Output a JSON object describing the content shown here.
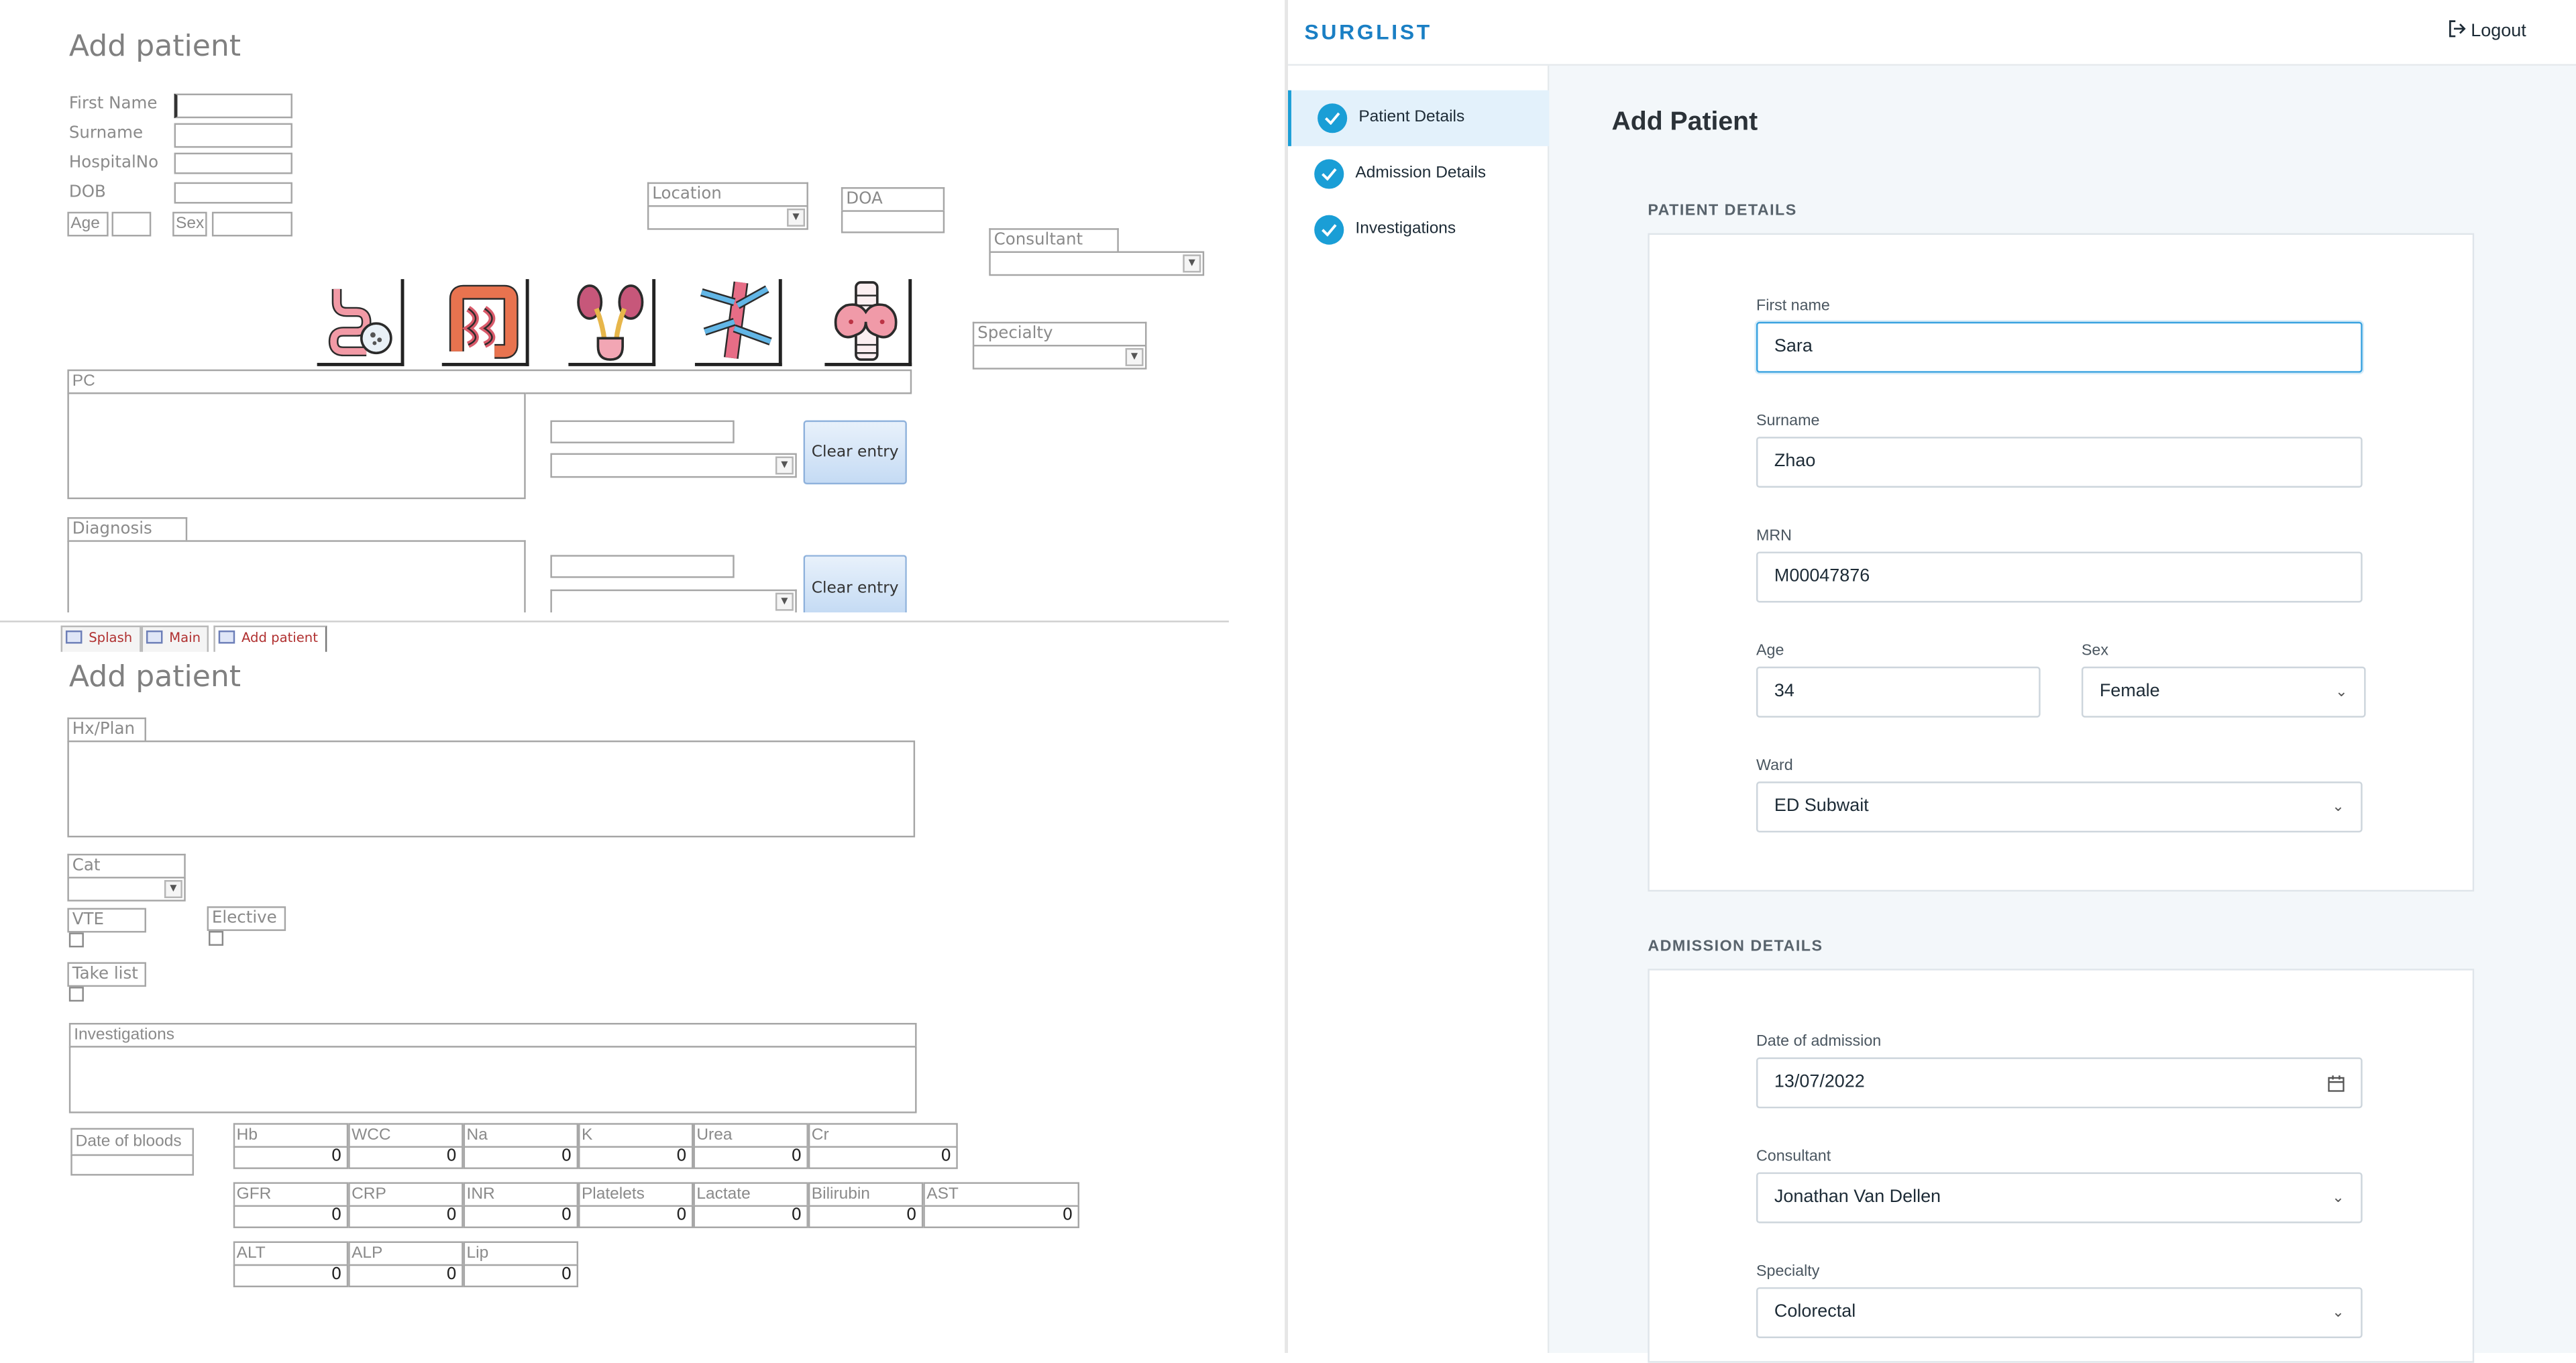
{
  "access": {
    "form_title_top": "Add patient",
    "form_title_bottom": "Add patient",
    "labels": {
      "first_name": "First Name",
      "surname": "Surname",
      "hospital_no": "HospitalNo",
      "dob": "DOB",
      "age": "Age",
      "sex": "Sex",
      "location": "Location",
      "doa": "DOA",
      "consultant": "Consultant",
      "specialty": "Specialty",
      "pc": "PC",
      "diagnosis": "Diagnosis",
      "hx_plan": "Hx/Plan",
      "cat": "Cat",
      "vte": "VTE",
      "elective": "Elective",
      "take_list": "Take list",
      "investigations": "Investigations",
      "date_of_bloods": "Date of bloods"
    },
    "clear_entry_label": "Clear entry",
    "tabs": [
      "Splash",
      "Main",
      "Add patient"
    ],
    "icons": [
      "small-intestine-icon",
      "large-intestine-icon",
      "kidneys-icon",
      "blood-vessels-icon",
      "thyroid-icon"
    ],
    "bloods_row1": [
      {
        "name": "Hb",
        "value": "0"
      },
      {
        "name": "WCC",
        "value": "0"
      },
      {
        "name": "Na",
        "value": "0"
      },
      {
        "name": "K",
        "value": "0"
      },
      {
        "name": "Urea",
        "value": "0"
      },
      {
        "name": "Cr",
        "value": "0"
      }
    ],
    "bloods_row2": [
      {
        "name": "GFR",
        "value": "0"
      },
      {
        "name": "CRP",
        "value": "0"
      },
      {
        "name": "INR",
        "value": "0"
      },
      {
        "name": "Platelets",
        "value": "0"
      },
      {
        "name": "Lactate",
        "value": "0"
      },
      {
        "name": "Bilirubin",
        "value": "0"
      },
      {
        "name": "AST",
        "value": "0"
      }
    ],
    "bloods_row3": [
      {
        "name": "ALT",
        "value": "0"
      },
      {
        "name": "ALP",
        "value": "0"
      },
      {
        "name": "Lip",
        "value": "0"
      }
    ]
  },
  "surglist": {
    "logo": "SURGLIST",
    "logout_label": "Logout",
    "steps": [
      "Patient Details",
      "Admission Details",
      "Investigations"
    ],
    "page_title": "Add Patient",
    "patient_section_title": "PATIENT DETAILS",
    "patient": {
      "first_name_label": "First name",
      "first_name": "Sara",
      "surname_label": "Surname",
      "surname": "Zhao",
      "mrn_label": "MRN",
      "mrn": "M00047876",
      "age_label": "Age",
      "age": "34",
      "sex_label": "Sex",
      "sex": "Female",
      "ward_label": "Ward",
      "ward": "ED Subwait"
    },
    "admission_section_title": "ADMISSION DETAILS",
    "admission": {
      "date_label": "Date of admission",
      "date": "13/07/2022",
      "consultant_label": "Consultant",
      "consultant": "Jonathan Van Dellen",
      "specialty_label": "Specialty",
      "specialty": "Colorectal"
    },
    "colors": {
      "accent": "#1a9ed6",
      "background": "#f3f7fa",
      "active_step": "#e3f1fb"
    }
  }
}
